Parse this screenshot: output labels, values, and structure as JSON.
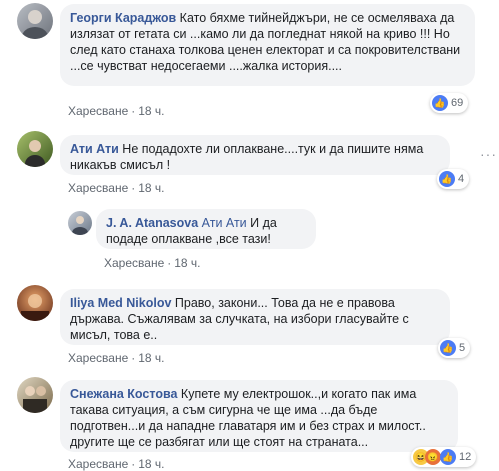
{
  "comments": [
    {
      "author": "Георги Караджов",
      "text": "Като бяхме тийнейджъри, не се осмеляваха да излязат от гетата си ...камо ли да погледнат някой на криво !!! Но след като станаха толкова ценен електорат и са покровителствани ...се чувстват недосегаеми ....жалка история....",
      "like_label": "Харесване",
      "time": "18 ч.",
      "reactions": "69",
      "avatar_color": "#8a8f99"
    },
    {
      "author": "Ати Ати",
      "text": "Не подадохте ли оплакване....тук и да пишите няма никакъв смисъл !",
      "like_label": "Харесване",
      "time": "18 ч.",
      "reactions": "4",
      "avatar_color": "#6f8e3f"
    },
    {
      "author": "J. A. Atanasova",
      "reply_to": "Ати Ати",
      "text": "И да подаде оплакване ,все тази!",
      "like_label": "Харесване",
      "time": "18 ч.",
      "avatar_color": "#7a8699"
    },
    {
      "author": "Iliya Med Nikolov",
      "text": "Право, закони... Това да не е правова държава. Съжалявам за случката, на избори гласувайте с мисъл, това е..",
      "like_label": "Харесване",
      "time": "18 ч.",
      "reactions": "5",
      "avatar_color": "#7a3b2a"
    },
    {
      "author": "Снежана Костова",
      "text": "Купете му електрошок..,и когато пак има такава ситуация, а съм сигурна че ще има ...да бъде подготвен...и да нападне главатаря им и без страх и милост.. другите ще се разбягат или ще стоят на страната...",
      "like_label": "Харесване",
      "time": "18 ч.",
      "reactions": "12",
      "avatar_color": "#9a8a6a"
    }
  ],
  "colors": {
    "link": "#385898",
    "bubble": "#f2f3f5",
    "like": "#4c7cf4"
  },
  "icons": {
    "like": "thumbs-up-icon",
    "haha": "haha-icon",
    "angry": "angry-icon",
    "more": "more-options-icon"
  }
}
